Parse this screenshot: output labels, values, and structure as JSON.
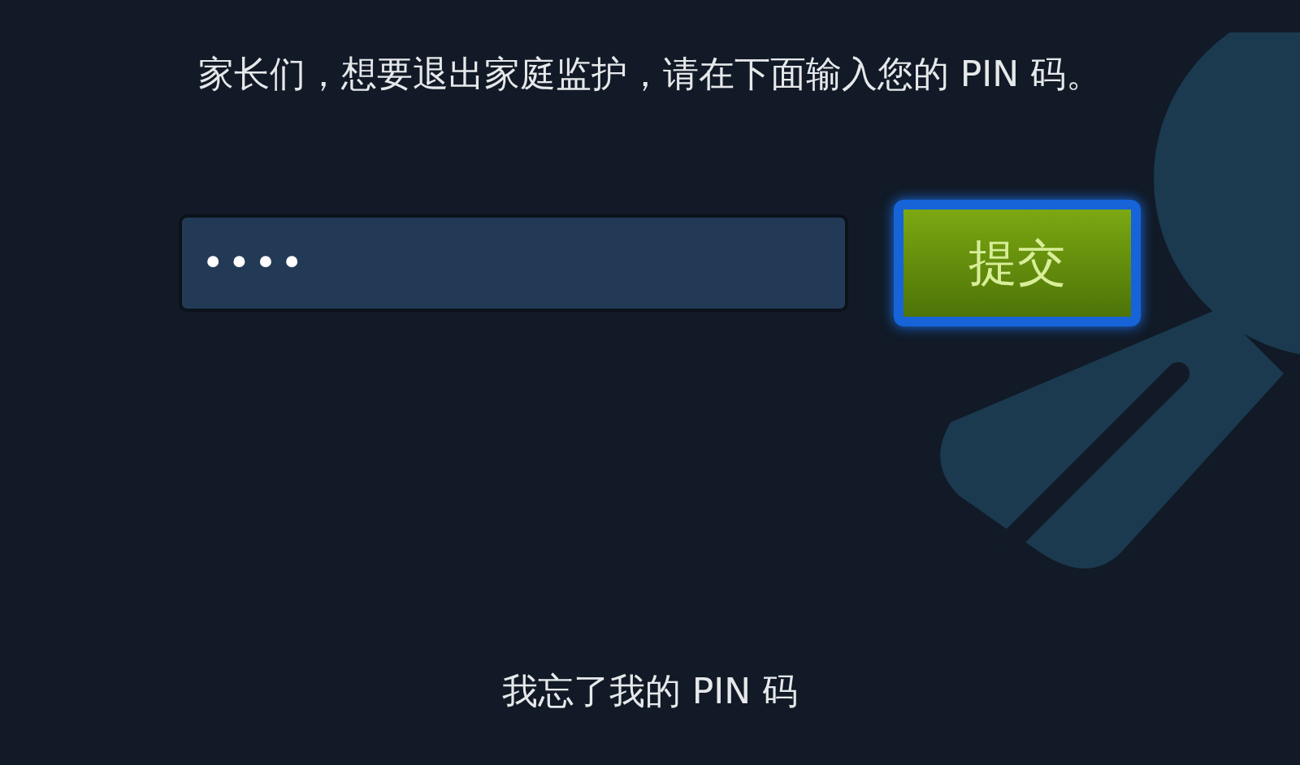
{
  "instruction": "家长们，想要退出家庭监护，请在下面输入您的 PIN 码。",
  "pin_field": {
    "value": "••••"
  },
  "submit_button": {
    "label": "提交",
    "focused": true
  },
  "forgot_link": "我忘了我的 PIN 码"
}
